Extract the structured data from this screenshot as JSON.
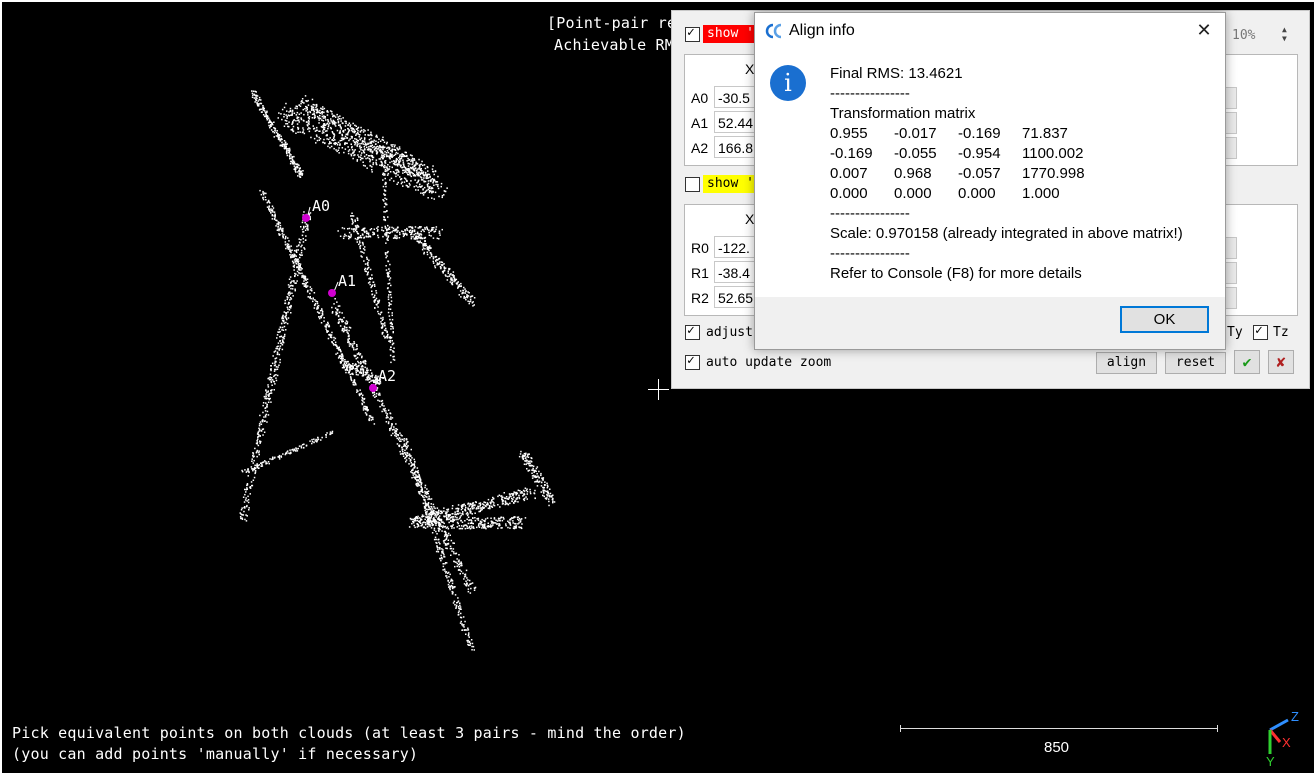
{
  "viewport": {
    "header_line1": "[Point-pair re",
    "header_line2": "Achievable RM",
    "hint_line1": "Pick equivalent points on both clouds (at least 3 pairs - mind the order)",
    "hint_line2": "(you can add points 'manually' if necessary)",
    "scale_value": "850",
    "point_labels": [
      "A0",
      "A1",
      "A2"
    ],
    "axis_labels": {
      "z": "Z",
      "x": "X",
      "y": "Y"
    },
    "colors": {
      "background": "#000000",
      "points": "#ffffff",
      "picked": "#d000d0"
    }
  },
  "panel": {
    "aligned": {
      "show_label": "show '",
      "show_checked": true,
      "show_color": "#ff0000",
      "col_x": "X",
      "rows": [
        {
          "label": "A0",
          "x": "-30.5"
        },
        {
          "label": "A1",
          "x": "52.44"
        },
        {
          "label": "A2",
          "x": "166.8"
        }
      ]
    },
    "reference": {
      "show_label": "show '",
      "show_checked": false,
      "show_color": "#ffff00",
      "col_x": "X",
      "rows": [
        {
          "label": "R0",
          "x": "-122."
        },
        {
          "label": "R1",
          "x": "-38.4"
        },
        {
          "label": "R2",
          "x": "52.65"
        }
      ]
    },
    "scale_spin": "10%",
    "adjust_label": "adjust",
    "adjust_checked": true,
    "ty_label": "Ty",
    "tz_label": "Tz",
    "tz_checked": true,
    "auto_zoom_label": "auto update zoom",
    "auto_zoom_checked": true,
    "align_label": "align",
    "reset_label": "reset",
    "apply_icon": "checkmark-icon",
    "cancel_icon": "cross-icon"
  },
  "dialog": {
    "title": "Align info",
    "close_glyph": "✕",
    "icon": "info-icon",
    "final_rms": "Final RMS: 13.4621",
    "separator": "----------------",
    "matrix_title": "Transformation matrix",
    "matrix": [
      [
        "0.955",
        "-0.017",
        "-0.169",
        "71.837"
      ],
      [
        "-0.169",
        "-0.055",
        "-0.954",
        "1100.002"
      ],
      [
        "0.007",
        "0.968",
        "-0.057",
        "1770.998"
      ],
      [
        "0.000",
        "0.000",
        "0.000",
        "1.000"
      ]
    ],
    "scale_text": "Scale: 0.970158 (already integrated in above matrix!)",
    "console_text": "Refer to Console (F8) for more details",
    "ok_label": "OK",
    "accent_color": "#0078d7"
  }
}
